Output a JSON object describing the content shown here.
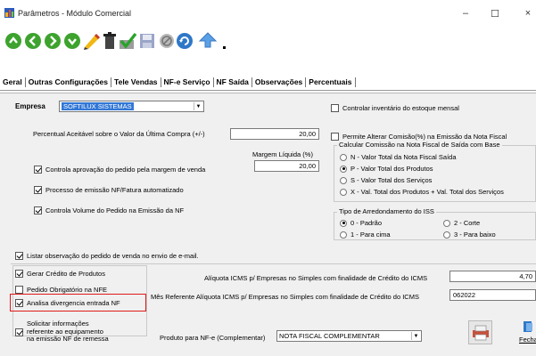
{
  "window": {
    "title": "Parâmetros  -  Módulo Comercial",
    "minimize": "–",
    "maximize": "☐",
    "close": "×"
  },
  "toolbar_icons": [
    "first-icon",
    "previous-icon",
    "next-icon",
    "last-icon",
    "edit-icon",
    "delete-icon",
    "confirm-icon",
    "save-icon",
    "cancel-icon",
    "refresh-icon",
    "help-icon"
  ],
  "tabs": [
    "Geral",
    "Outras Configurações",
    "Tele Vendas",
    "NF-e Serviço",
    "NF Saída",
    "Observações",
    "Percentuais"
  ],
  "empresa": {
    "label": "Empresa",
    "value": "SOFTILUX SISTEMAS"
  },
  "controlar_inventario": {
    "label": "Controlar inventário do estoque mensal",
    "checked": false
  },
  "percentual": {
    "label": "Percentual Aceitável sobre o Valor da Última Compra (+/-)",
    "value": "20,00"
  },
  "margem": {
    "label": "Margem Líquida (%)",
    "value": "20,00"
  },
  "checks_left": [
    {
      "label": "Controla aprovação do pedido pela margem de venda",
      "checked": true
    },
    {
      "label": "Processo de emissão NF/Fatura automatizado",
      "checked": true
    },
    {
      "label": "Controla Volume do Pedido na Emissão da NF",
      "checked": true
    }
  ],
  "permite_alterar": {
    "label": "Permite Alterar Comisão(%) na Emissão da Nota Fiscal",
    "checked": false
  },
  "calc_comissao": {
    "title": "Calcular Comissão na Nota Fiscal de Saída com Base",
    "options": [
      {
        "label": "N - Valor Total da Nota Fiscal Saída",
        "checked": false
      },
      {
        "label": "P - Valor Total dos Produtos",
        "checked": true
      },
      {
        "label": "S - Valor Total dos Serviços",
        "checked": false
      },
      {
        "label": "X - Val. Total dos Produtos + Val. Total dos Serviços",
        "checked": false
      }
    ]
  },
  "arredondamento": {
    "title": "Tipo de Arredondamento do ISS",
    "options": [
      {
        "label": "0 - Padrão",
        "checked": true
      },
      {
        "label": "2 - Corte",
        "checked": false
      },
      {
        "label": "1 - Para cima",
        "checked": false
      },
      {
        "label": "3 - Para baixo",
        "checked": false
      }
    ]
  },
  "listar_obs": {
    "label": "Listar observação do pedido de venda no envio de e-mail.",
    "checked": true
  },
  "gerar_credito": {
    "label": "Gerar Crédito de Produtos",
    "checked": true
  },
  "pedido_obrig": {
    "label": "Pedido Obrigatório na NFE",
    "checked": false
  },
  "analisa_div": {
    "label": "Analisa divergencia entrada NF",
    "checked": true
  },
  "solicitar": {
    "label_1": "Solicitar informações",
    "label_2": "referente ao equipamento",
    "label_3": "na emissão NF de remessa",
    "checked": true
  },
  "aliquota": {
    "label": "Alíquota ICMS p/ Empresas no Simples com finalidade de Crédito do ICMS",
    "value": "4,70"
  },
  "mes_ref": {
    "label": "Mês Referente Alíquota ICMS p/ Empresas no Simples com finalidade de Crédito do ICMS",
    "value": "062022"
  },
  "produto_nfe": {
    "label": "Produto para NF-e (Complementar)",
    "value": "NOTA FISCAL COMPLEMENTAR"
  },
  "fechar_label": "Fecha"
}
